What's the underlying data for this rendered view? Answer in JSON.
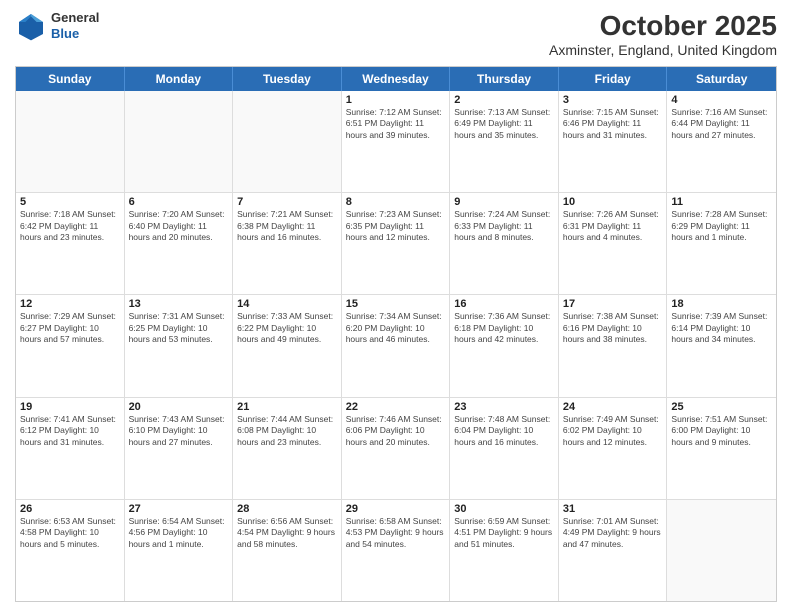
{
  "header": {
    "logo_general": "General",
    "logo_blue": "Blue",
    "title": "October 2025",
    "subtitle": "Axminster, England, United Kingdom"
  },
  "days_of_week": [
    "Sunday",
    "Monday",
    "Tuesday",
    "Wednesday",
    "Thursday",
    "Friday",
    "Saturday"
  ],
  "weeks": [
    [
      {
        "day": "",
        "info": ""
      },
      {
        "day": "",
        "info": ""
      },
      {
        "day": "",
        "info": ""
      },
      {
        "day": "1",
        "info": "Sunrise: 7:12 AM\nSunset: 6:51 PM\nDaylight: 11 hours and 39 minutes."
      },
      {
        "day": "2",
        "info": "Sunrise: 7:13 AM\nSunset: 6:49 PM\nDaylight: 11 hours and 35 minutes."
      },
      {
        "day": "3",
        "info": "Sunrise: 7:15 AM\nSunset: 6:46 PM\nDaylight: 11 hours and 31 minutes."
      },
      {
        "day": "4",
        "info": "Sunrise: 7:16 AM\nSunset: 6:44 PM\nDaylight: 11 hours and 27 minutes."
      }
    ],
    [
      {
        "day": "5",
        "info": "Sunrise: 7:18 AM\nSunset: 6:42 PM\nDaylight: 11 hours and 23 minutes."
      },
      {
        "day": "6",
        "info": "Sunrise: 7:20 AM\nSunset: 6:40 PM\nDaylight: 11 hours and 20 minutes."
      },
      {
        "day": "7",
        "info": "Sunrise: 7:21 AM\nSunset: 6:38 PM\nDaylight: 11 hours and 16 minutes."
      },
      {
        "day": "8",
        "info": "Sunrise: 7:23 AM\nSunset: 6:35 PM\nDaylight: 11 hours and 12 minutes."
      },
      {
        "day": "9",
        "info": "Sunrise: 7:24 AM\nSunset: 6:33 PM\nDaylight: 11 hours and 8 minutes."
      },
      {
        "day": "10",
        "info": "Sunrise: 7:26 AM\nSunset: 6:31 PM\nDaylight: 11 hours and 4 minutes."
      },
      {
        "day": "11",
        "info": "Sunrise: 7:28 AM\nSunset: 6:29 PM\nDaylight: 11 hours and 1 minute."
      }
    ],
    [
      {
        "day": "12",
        "info": "Sunrise: 7:29 AM\nSunset: 6:27 PM\nDaylight: 10 hours and 57 minutes."
      },
      {
        "day": "13",
        "info": "Sunrise: 7:31 AM\nSunset: 6:25 PM\nDaylight: 10 hours and 53 minutes."
      },
      {
        "day": "14",
        "info": "Sunrise: 7:33 AM\nSunset: 6:22 PM\nDaylight: 10 hours and 49 minutes."
      },
      {
        "day": "15",
        "info": "Sunrise: 7:34 AM\nSunset: 6:20 PM\nDaylight: 10 hours and 46 minutes."
      },
      {
        "day": "16",
        "info": "Sunrise: 7:36 AM\nSunset: 6:18 PM\nDaylight: 10 hours and 42 minutes."
      },
      {
        "day": "17",
        "info": "Sunrise: 7:38 AM\nSunset: 6:16 PM\nDaylight: 10 hours and 38 minutes."
      },
      {
        "day": "18",
        "info": "Sunrise: 7:39 AM\nSunset: 6:14 PM\nDaylight: 10 hours and 34 minutes."
      }
    ],
    [
      {
        "day": "19",
        "info": "Sunrise: 7:41 AM\nSunset: 6:12 PM\nDaylight: 10 hours and 31 minutes."
      },
      {
        "day": "20",
        "info": "Sunrise: 7:43 AM\nSunset: 6:10 PM\nDaylight: 10 hours and 27 minutes."
      },
      {
        "day": "21",
        "info": "Sunrise: 7:44 AM\nSunset: 6:08 PM\nDaylight: 10 hours and 23 minutes."
      },
      {
        "day": "22",
        "info": "Sunrise: 7:46 AM\nSunset: 6:06 PM\nDaylight: 10 hours and 20 minutes."
      },
      {
        "day": "23",
        "info": "Sunrise: 7:48 AM\nSunset: 6:04 PM\nDaylight: 10 hours and 16 minutes."
      },
      {
        "day": "24",
        "info": "Sunrise: 7:49 AM\nSunset: 6:02 PM\nDaylight: 10 hours and 12 minutes."
      },
      {
        "day": "25",
        "info": "Sunrise: 7:51 AM\nSunset: 6:00 PM\nDaylight: 10 hours and 9 minutes."
      }
    ],
    [
      {
        "day": "26",
        "info": "Sunrise: 6:53 AM\nSunset: 4:58 PM\nDaylight: 10 hours and 5 minutes."
      },
      {
        "day": "27",
        "info": "Sunrise: 6:54 AM\nSunset: 4:56 PM\nDaylight: 10 hours and 1 minute."
      },
      {
        "day": "28",
        "info": "Sunrise: 6:56 AM\nSunset: 4:54 PM\nDaylight: 9 hours and 58 minutes."
      },
      {
        "day": "29",
        "info": "Sunrise: 6:58 AM\nSunset: 4:53 PM\nDaylight: 9 hours and 54 minutes."
      },
      {
        "day": "30",
        "info": "Sunrise: 6:59 AM\nSunset: 4:51 PM\nDaylight: 9 hours and 51 minutes."
      },
      {
        "day": "31",
        "info": "Sunrise: 7:01 AM\nSunset: 4:49 PM\nDaylight: 9 hours and 47 minutes."
      },
      {
        "day": "",
        "info": ""
      }
    ]
  ]
}
